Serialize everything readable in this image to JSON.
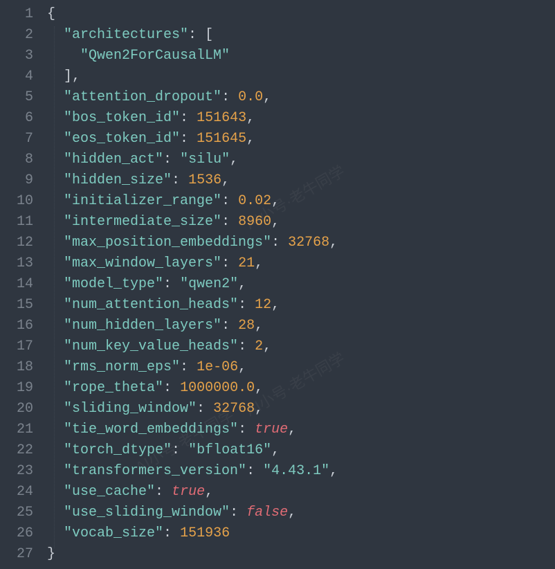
{
  "line_numbers": [
    "1",
    "2",
    "3",
    "4",
    "5",
    "6",
    "7",
    "8",
    "9",
    "10",
    "11",
    "12",
    "13",
    "14",
    "15",
    "16",
    "17",
    "18",
    "19",
    "20",
    "21",
    "22",
    "23",
    "24",
    "25",
    "26",
    "27"
  ],
  "config": {
    "architectures": [
      "Qwen2ForCausalLM"
    ],
    "attention_dropout": 0.0,
    "bos_token_id": 151643,
    "eos_token_id": 151645,
    "hidden_act": "silu",
    "hidden_size": 1536,
    "initializer_range": 0.02,
    "intermediate_size": 8960,
    "max_position_embeddings": 32768,
    "max_window_layers": 21,
    "model_type": "qwen2",
    "num_attention_heads": 12,
    "num_hidden_layers": 28,
    "num_key_value_heads": 2,
    "rms_norm_eps": "1e-06",
    "rope_theta": 1000000.0,
    "sliding_window": 32768,
    "tie_word_embeddings": true,
    "torch_dtype": "bfloat16",
    "transformers_version": "4.43.1",
    "use_cache": true,
    "use_sliding_window": false,
    "vocab_size": 151936
  },
  "display_lines": [
    "{",
    "  \"architectures\": [",
    "    \"Qwen2ForCausalLM\"",
    "  ],",
    "  \"attention_dropout\": 0.0,",
    "  \"bos_token_id\": 151643,",
    "  \"eos_token_id\": 151645,",
    "  \"hidden_act\": \"silu\",",
    "  \"hidden_size\": 1536,",
    "  \"initializer_range\": 0.02,",
    "  \"intermediate_size\": 8960,",
    "  \"max_position_embeddings\": 32768,",
    "  \"max_window_layers\": 21,",
    "  \"model_type\": \"qwen2\",",
    "  \"num_attention_heads\": 12,",
    "  \"num_hidden_layers\": 28,",
    "  \"num_key_value_heads\": 2,",
    "  \"rms_norm_eps\": 1e-06,",
    "  \"rope_theta\": 1000000.0,",
    "  \"sliding_window\": 32768,",
    "  \"tie_word_embeddings\": true,",
    "  \"torch_dtype\": \"bfloat16\",",
    "  \"transformers_version\": \"4.43.1\",",
    "  \"use_cache\": true,",
    "  \"use_sliding_window\": false,",
    "  \"vocab_size\": 151936",
    "}"
  ],
  "watermark_text": "AI小号·老牛同学"
}
